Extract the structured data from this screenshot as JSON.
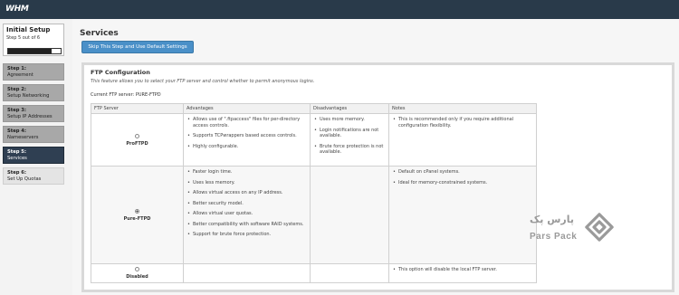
{
  "app": {
    "logo": "WHM"
  },
  "sidebar": {
    "title": "Initial Setup",
    "subtitle": "Step 5 out of 6",
    "progress_fraction": 0.833,
    "steps": [
      {
        "num": "Step 1:",
        "label": "Agreement",
        "state": "done"
      },
      {
        "num": "Step 2:",
        "label": "Setup Networking",
        "state": "done"
      },
      {
        "num": "Step 3:",
        "label": "Setup IP Addresses",
        "state": "done"
      },
      {
        "num": "Step 4:",
        "label": "Nameservers",
        "state": "done"
      },
      {
        "num": "Step 5:",
        "label": "Services",
        "state": "active"
      },
      {
        "num": "Step 6:",
        "label": "Set Up Quotas",
        "state": "future"
      }
    ]
  },
  "main": {
    "title": "Services",
    "skip_button": "Skip This Step and Use Default Settings",
    "ftp": {
      "title": "FTP Configuration",
      "description": "This feature allows you to select your FTP server and control whether to permit anonymous logins.",
      "current": "Current FTP server:  PURE-FTPD",
      "columns": [
        "FTP Server",
        "Advantages",
        "Disadvantages",
        "Notes"
      ],
      "rows": [
        {
          "name": "ProFTPD",
          "selected": false,
          "advantages": [
            "Allows use of \".ftpaccess\" files for per-directory access controls.",
            "Supports TCPwrappers based access controls.",
            "Highly configurable."
          ],
          "disadvantages": [
            "Uses more memory.",
            "Login notifications are not available.",
            "Brute force protection is not available."
          ],
          "notes": [
            "This is recommended only if you require additional configuration flexibility."
          ]
        },
        {
          "name": "Pure-FTPD",
          "selected": true,
          "advantages": [
            "Faster login time.",
            "Uses less memory.",
            "Allows virtual access on any IP address.",
            "Better security model.",
            "Allows virtual user quotas.",
            "Better compatibility with software RAID systems.",
            "Support for brute force protection."
          ],
          "disadvantages": [],
          "notes": [
            "Default on cPanel systems.",
            "Ideal for memory-constrained systems."
          ]
        },
        {
          "name": "Disabled",
          "selected": false,
          "advantages": [],
          "disadvantages": [],
          "notes": [
            "This option will disable the local FTP server."
          ]
        }
      ]
    }
  },
  "watermark": {
    "fa": "پارس پک",
    "en": "Pars Pack"
  }
}
